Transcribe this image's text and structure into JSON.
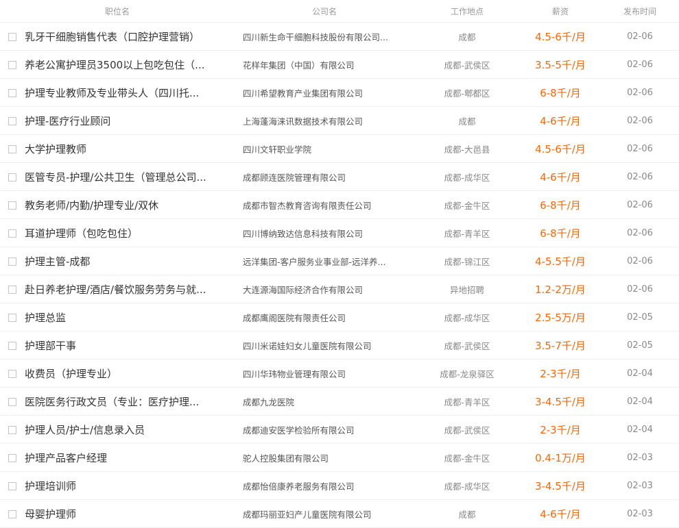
{
  "table": {
    "headers": {
      "title": "职位名",
      "company": "公司名",
      "location": "工作地点",
      "salary": "薪资",
      "date": "发布时间"
    },
    "rows": [
      {
        "title": "乳牙干细胞销售代表（口腔护理营销）",
        "company": "四川新生命干细胞科技股份有限公司...",
        "location": "成都",
        "salary": "4.5-6千/月",
        "date": "02-06"
      },
      {
        "title": "养老公寓护理员3500以上包吃包住（...",
        "company": "花样年集团（中国）有限公司",
        "location": "成都-武侯区",
        "salary": "3.5-5千/月",
        "date": "02-06"
      },
      {
        "title": "护理专业教师及专业带头人（四川托...",
        "company": "四川希望教育产业集团有限公司",
        "location": "成都-郫都区",
        "salary": "6-8千/月",
        "date": "02-06"
      },
      {
        "title": "护理-医疗行业顾问",
        "company": "上海蓬海涞讯数据技术有限公司",
        "location": "成都",
        "salary": "4-6千/月",
        "date": "02-06"
      },
      {
        "title": "大学护理教师",
        "company": "四川文轩职业学院",
        "location": "成都-大邑县",
        "salary": "4.5-6千/月",
        "date": "02-06"
      },
      {
        "title": "医管专员-护理/公共卫生（管理总公司...",
        "company": "成都顾连医院管理有限公司",
        "location": "成都-成华区",
        "salary": "4-6千/月",
        "date": "02-06"
      },
      {
        "title": "教务老师/内勤/护理专业/双休",
        "company": "成都市智杰教育咨询有限责任公司",
        "location": "成都-金牛区",
        "salary": "6-8千/月",
        "date": "02-06"
      },
      {
        "title": "耳道护理师（包吃包住）",
        "company": "四川博纳致达信息科技有限公司",
        "location": "成都-青羊区",
        "salary": "6-8千/月",
        "date": "02-06"
      },
      {
        "title": "护理主管-成都",
        "company": "远洋集团-客户服务业事业部-远洋养...",
        "location": "成都-锦江区",
        "salary": "4-5.5千/月",
        "date": "02-06"
      },
      {
        "title": "赴日养老护理/酒店/餐饮服务劳务与就...",
        "company": "大连源海国际经济合作有限公司",
        "location": "异地招聘",
        "salary": "1.2-2万/月",
        "date": "02-06"
      },
      {
        "title": "护理总监",
        "company": "成都鹰阁医院有限责任公司",
        "location": "成都-成华区",
        "salary": "2.5-5万/月",
        "date": "02-05"
      },
      {
        "title": "护理部干事",
        "company": "四川米诺娃妇女儿童医院有限公司",
        "location": "成都-武侯区",
        "salary": "3.5-7千/月",
        "date": "02-05"
      },
      {
        "title": "收费员（护理专业）",
        "company": "四川华玮物业管理有限公司",
        "location": "成都-龙泉驿区",
        "salary": "2-3千/月",
        "date": "02-04"
      },
      {
        "title": "医院医务行政文员（专业：医疗护理...",
        "company": "成都九龙医院",
        "location": "成都-青羊区",
        "salary": "3-4.5千/月",
        "date": "02-04"
      },
      {
        "title": "护理人员/护士/信息录入员",
        "company": "成都迪安医学检验所有限公司",
        "location": "成都-武侯区",
        "salary": "2-3千/月",
        "date": "02-04"
      },
      {
        "title": "护理产品客户经理",
        "company": "驼人控股集团有限公司",
        "location": "成都-金牛区",
        "salary": "0.4-1万/月",
        "date": "02-03"
      },
      {
        "title": "护理培训师",
        "company": "成都怡倍康养老服务有限公司",
        "location": "成都-成华区",
        "salary": "3-4.5千/月",
        "date": "02-03"
      },
      {
        "title": "母婴护理师",
        "company": "成都玛丽亚妇产儿童医院有限公司",
        "location": "成都",
        "salary": "4-6千/月",
        "date": "02-03"
      }
    ]
  },
  "colors": {
    "salary": "#ff6600",
    "header_text": "#999999",
    "row_border": "#eeeeee"
  }
}
